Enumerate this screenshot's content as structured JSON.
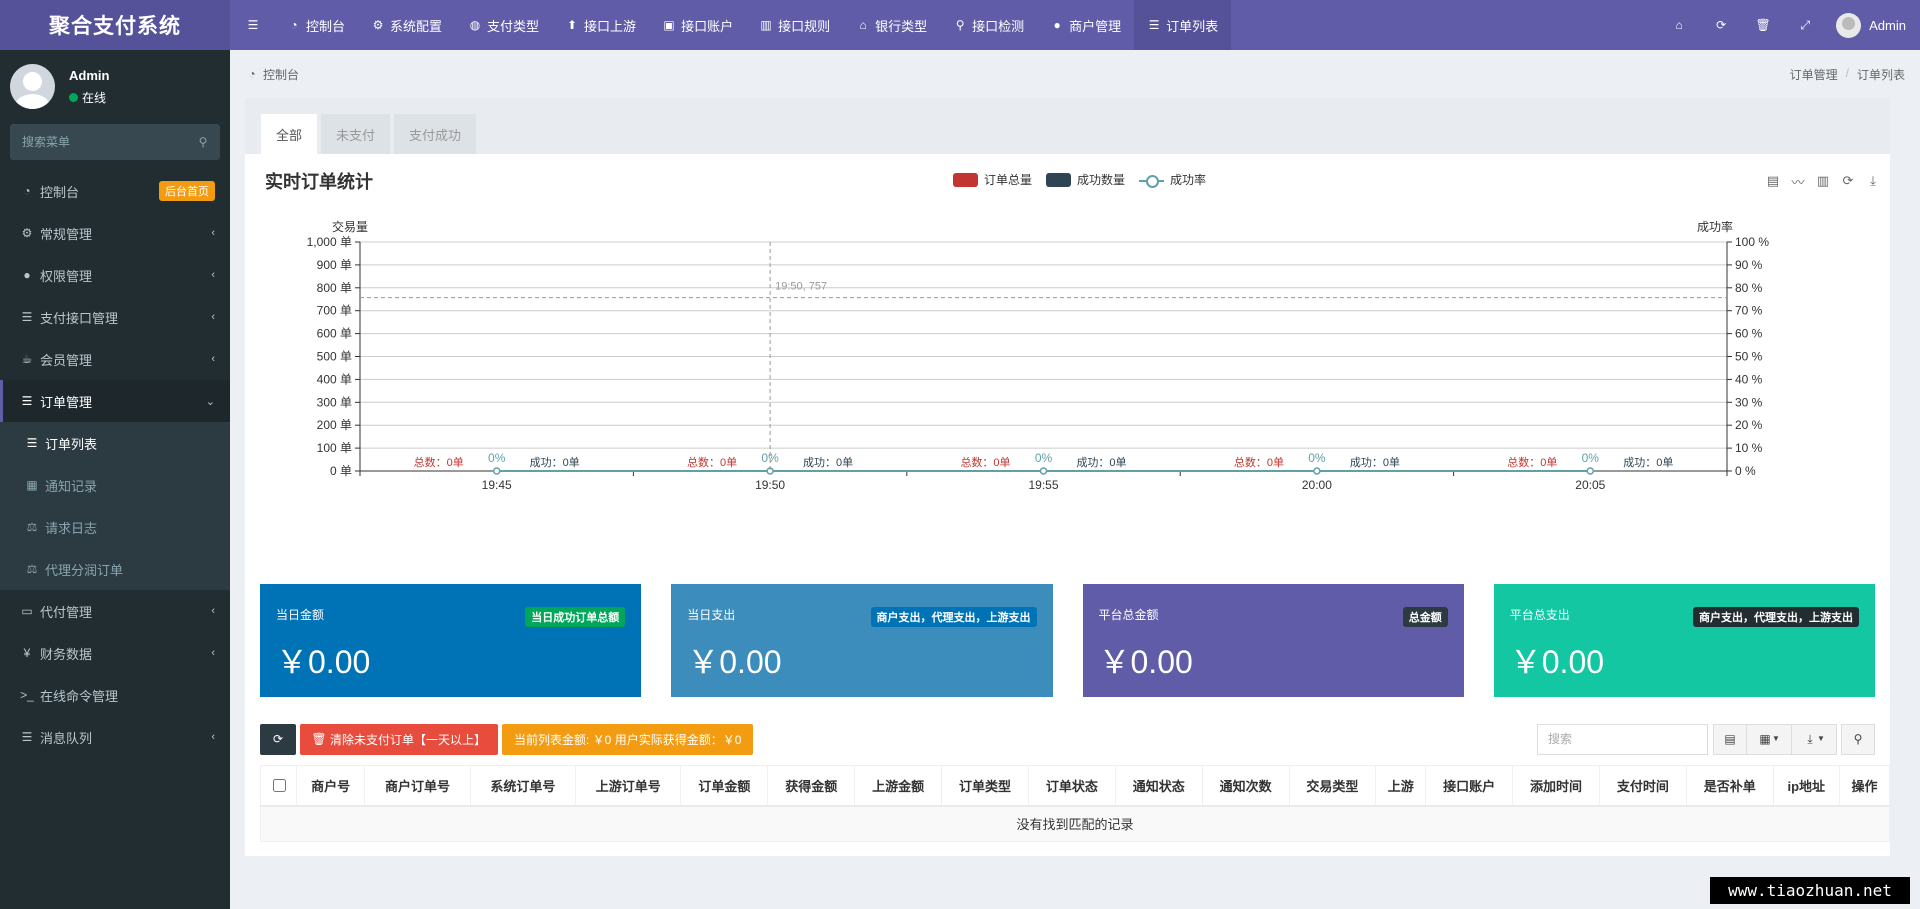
{
  "app": {
    "title": "聚合支付系统"
  },
  "topnav": [
    {
      "label": "控制台",
      "icon": "dashboard-icon"
    },
    {
      "label": "系统配置",
      "icon": "gear-icon"
    },
    {
      "label": "支付类型",
      "icon": "globe-icon"
    },
    {
      "label": "接口上游",
      "icon": "arrow-up-icon"
    },
    {
      "label": "接口账户",
      "icon": "account-icon"
    },
    {
      "label": "接口规则",
      "icon": "barcode-icon"
    },
    {
      "label": "银行类型",
      "icon": "bank-icon"
    },
    {
      "label": "接口检测",
      "icon": "search-icon"
    },
    {
      "label": "商户管理",
      "icon": "user-icon"
    },
    {
      "label": "订单列表",
      "icon": "list-icon"
    }
  ],
  "topbar_user": {
    "name": "Admin"
  },
  "sidebar": {
    "user": {
      "name": "Admin",
      "status": "在线"
    },
    "search_placeholder": "搜索菜单",
    "dashboard": {
      "label": "控制台",
      "badge": "后台首页"
    },
    "items": [
      {
        "label": "常规管理",
        "icon": "cogs-icon"
      },
      {
        "label": "权限管理",
        "icon": "users-icon"
      },
      {
        "label": "支付接口管理",
        "icon": "list-icon"
      },
      {
        "label": "会员管理",
        "icon": "cup-icon"
      }
    ],
    "order_mgmt": {
      "label": "订单管理"
    },
    "submenu": [
      {
        "label": "订单列表",
        "icon": "list-icon",
        "active": true
      },
      {
        "label": "通知记录",
        "icon": "calendar-icon"
      },
      {
        "label": "请求日志",
        "icon": "balance-icon"
      },
      {
        "label": "代理分润订单",
        "icon": "balance-icon"
      }
    ],
    "items_after": [
      {
        "label": "代付管理",
        "icon": "money-icon"
      },
      {
        "label": "财务数据",
        "icon": "yen-icon"
      }
    ],
    "online_cmd": {
      "label": "在线命令管理"
    },
    "msg_queue": {
      "label": "消息队列"
    }
  },
  "header": {
    "title": "控制台",
    "breadcrumb": [
      "订单管理",
      "订单列表"
    ]
  },
  "tabs": [
    "全部",
    "未支付",
    "支付成功"
  ],
  "chart_data": {
    "type": "bar",
    "title": "实时订单统计",
    "legend": [
      "订单总量",
      "成功数量",
      "成功率"
    ],
    "legend_colors": [
      "#c23531",
      "#2f4554",
      "#61a0a8"
    ],
    "y_left_label": "交易量",
    "y_right_label": "成功率",
    "y_left_unit": "单",
    "y_right_unit": "%",
    "ylim": [
      0,
      1000
    ],
    "ylim_right": [
      0,
      100
    ],
    "y_ticks": [
      0,
      100,
      200,
      300,
      400,
      500,
      600,
      700,
      800,
      900,
      1000
    ],
    "y_tick_labels": [
      "0 单",
      "100 单",
      "200 单",
      "300 单",
      "400 单",
      "500 单",
      "600 单",
      "700 单",
      "800 单",
      "900 单",
      "1,000 单"
    ],
    "y_right_ticks": [
      0,
      10,
      20,
      30,
      40,
      50,
      60,
      70,
      80,
      90,
      100
    ],
    "y_right_tick_labels": [
      "0 %",
      "10 %",
      "20 %",
      "30 %",
      "40 %",
      "50 %",
      "60 %",
      "70 %",
      "80 %",
      "90 %",
      "100 %"
    ],
    "categories": [
      "19:45",
      "19:50",
      "19:55",
      "20:00",
      "20:05"
    ],
    "series": [
      {
        "name": "订单总量",
        "values": [
          0,
          0,
          0,
          0,
          0
        ],
        "label_prefix": "总数：",
        "label_suffix": "单"
      },
      {
        "name": "成功数量",
        "values": [
          0,
          0,
          0,
          0,
          0
        ],
        "label_prefix": "成功：",
        "label_suffix": "单"
      },
      {
        "name": "成功率",
        "values": [
          0,
          0,
          0,
          0,
          0
        ],
        "label_suffix": "%"
      }
    ],
    "crosshair": {
      "x": "19:50",
      "y": 757,
      "label": "19:50, 757"
    },
    "grid": true,
    "legend_position": "top-center"
  },
  "cards": [
    {
      "label": "当日金额",
      "badge": "当日成功订单总额",
      "value": "￥0.00",
      "bg": "#0073b7",
      "badge_bg": "#00a65a",
      "badge_color": "#fff"
    },
    {
      "label": "当日支出",
      "badge": "商户支出，代理支出，上游支出",
      "value": "￥0.00",
      "bg": "#3c8dbc",
      "badge_bg": "#0073b7",
      "badge_color": "#fff"
    },
    {
      "label": "平台总金额",
      "badge": "总金额",
      "value": "￥0.00",
      "bg": "#605ca8",
      "badge_bg": "#2c3b41",
      "badge_color": "#fff"
    },
    {
      "label": "平台总支出",
      "badge": "商户支出，代理支出，上游支出",
      "value": "￥0.00",
      "bg": "#13c7a3",
      "badge_bg": "#222d32",
      "badge_color": "#fff"
    }
  ],
  "toolbar": {
    "clear_label": "清除未支付订单【一天以上】",
    "summary_label": "当前列表金额: ￥0  用户实际获得金额：￥0",
    "search_placeholder": "搜索"
  },
  "table": {
    "columns": [
      "商户号",
      "商户订单号",
      "系统订单号",
      "上游订单号",
      "订单金额",
      "获得金额",
      "上游金额",
      "订单类型",
      "订单状态",
      "通知状态",
      "通知次数",
      "交易类型",
      "上游",
      "接口账户",
      "添加时间",
      "支付时间",
      "是否补单",
      "ip地址",
      "操作"
    ],
    "empty_text": "没有找到匹配的记录"
  },
  "watermark": "www.tiaozhuan.net"
}
